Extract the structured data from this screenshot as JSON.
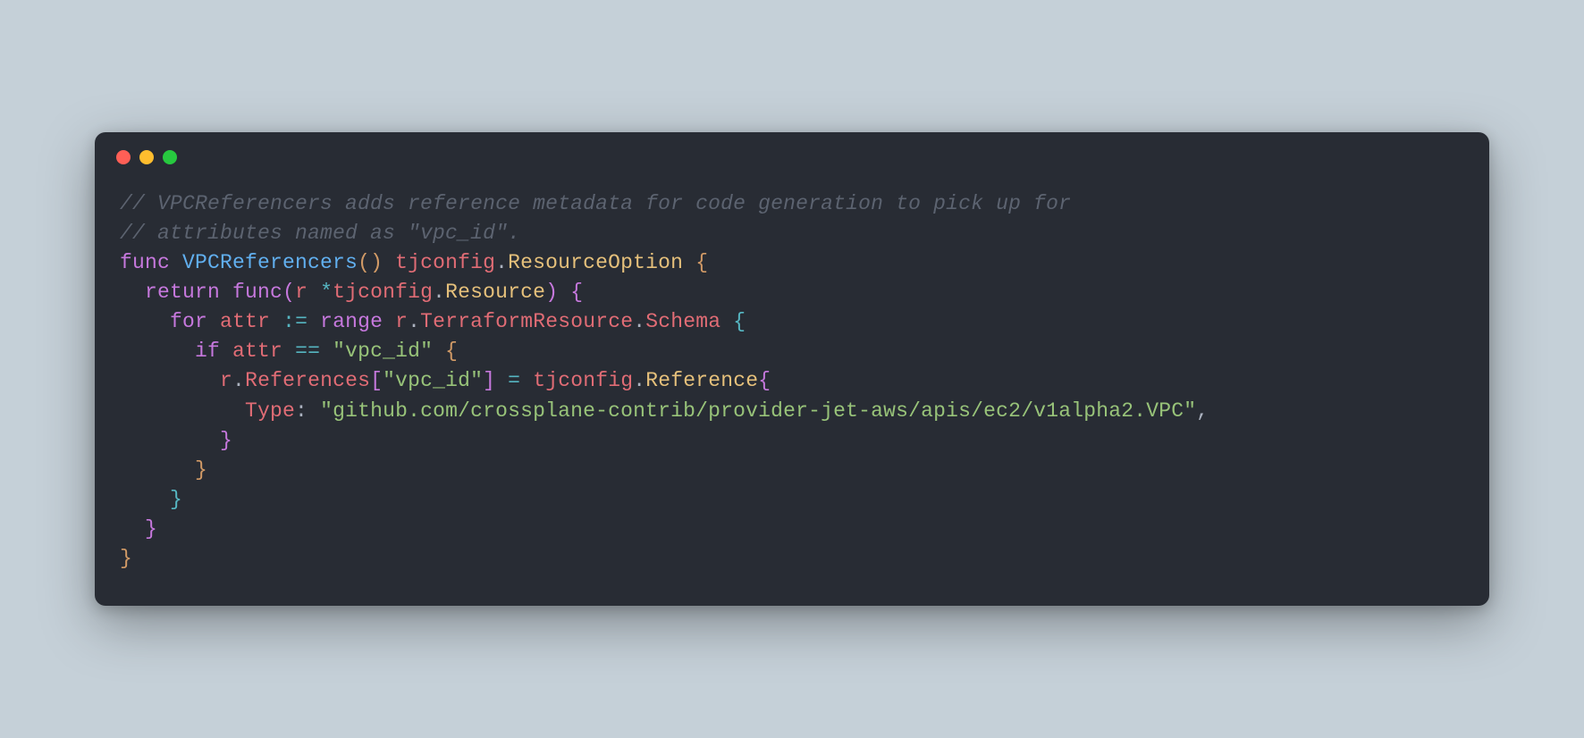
{
  "window": {
    "buttons": [
      "close",
      "minimize",
      "zoom"
    ]
  },
  "code": {
    "lines": {
      "c1": "// VPCReferencers adds reference metadata for code generation to pick up for",
      "c2": "// attributes named as \"vpc_id\".",
      "l1_func": "func",
      "l1_name": "VPCReferencers",
      "l1_parens": "()",
      "l1_sp": " ",
      "l1_pkg": "tjconfig",
      "l1_dot": ".",
      "l1_ret": "ResourceOption",
      "l1_ob": " {",
      "l2_indent": "  ",
      "l2_return": "return",
      "l2_sp": " ",
      "l2_func": "func",
      "l2_op": "(",
      "l2_r": "r",
      "l2_star": " *",
      "l2_pkg": "tjconfig",
      "l2_dot": ".",
      "l2_type": "Resource",
      "l2_cp": ")",
      "l2_ob": " {",
      "l3_indent": "    ",
      "l3_for": "for",
      "l3_sp1": " ",
      "l3_attr": "attr",
      "l3_sp2": " ",
      "l3_assign": ":=",
      "l3_sp3": " ",
      "l3_range": "range",
      "l3_sp4": " ",
      "l3_r": "r",
      "l3_dot1": ".",
      "l3_tr": "TerraformResource",
      "l3_dot2": ".",
      "l3_schema": "Schema",
      "l3_ob": " {",
      "l4_indent": "      ",
      "l4_if": "if",
      "l4_sp1": " ",
      "l4_attr": "attr",
      "l4_sp2": " ",
      "l4_eq": "==",
      "l4_sp3": " ",
      "l4_str": "\"vpc_id\"",
      "l4_ob": " {",
      "l5_indent": "        ",
      "l5_r": "r",
      "l5_dot": ".",
      "l5_refs": "References",
      "l5_ob": "[",
      "l5_str": "\"vpc_id\"",
      "l5_cb": "]",
      "l5_sp1": " ",
      "l5_assign": "=",
      "l5_sp2": " ",
      "l5_pkg": "tjconfig",
      "l5_dot2": ".",
      "l5_ref": "Reference",
      "l5_brace": "{",
      "l6_indent": "          ",
      "l6_type": "Type",
      "l6_colon": ": ",
      "l6_str": "\"github.com/crossplane-contrib/provider-jet-aws/apis/ec2/v1alpha2.VPC\"",
      "l6_comma": ",",
      "l7": "        }",
      "l8": "      }",
      "l9": "    }",
      "l10": "  }",
      "l11": "}"
    }
  }
}
